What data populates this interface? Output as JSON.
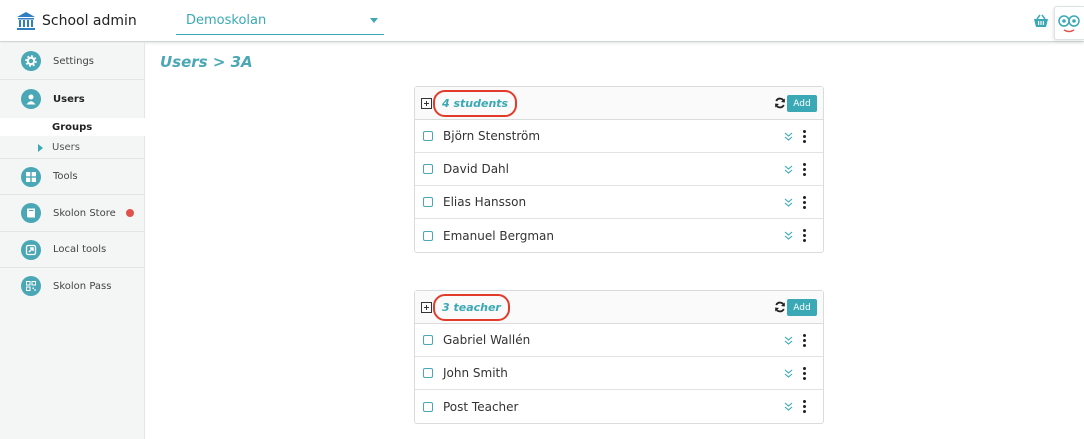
{
  "header": {
    "title": "School admin",
    "school_select": {
      "value": "Demoskolan"
    },
    "icons": {
      "brand": "bank-icon",
      "basket": "basket-icon",
      "avatar": "owl-avatar-icon"
    }
  },
  "sidebar": {
    "items": [
      {
        "label": "Settings",
        "icon": "gear-icon"
      },
      {
        "label": "Users",
        "icon": "user-icon",
        "active": true
      },
      {
        "label": "Tools",
        "icon": "grid-icon"
      },
      {
        "label": "Skolon Store",
        "icon": "book-icon",
        "badge": true
      },
      {
        "label": "Local tools",
        "icon": "external-arrow-icon"
      },
      {
        "label": "Skolon Pass",
        "icon": "qr-code-icon"
      }
    ],
    "sub_items": [
      {
        "label": "Groups"
      },
      {
        "label": "Users"
      }
    ]
  },
  "main": {
    "breadcrumb": "Users > 3A",
    "panels": [
      {
        "count_label": "4 students",
        "add_label": "Add",
        "rows": [
          {
            "name": "Björn Stenström"
          },
          {
            "name": "David Dahl"
          },
          {
            "name": "Elias Hansson"
          },
          {
            "name": "Emanuel Bergman"
          }
        ]
      },
      {
        "count_label": "3 teacher",
        "add_label": "Add",
        "rows": [
          {
            "name": "Gabriel Wallén"
          },
          {
            "name": "John Smith"
          },
          {
            "name": "Post Teacher"
          }
        ]
      }
    ]
  },
  "colors": {
    "accent": "#3aa9b5",
    "highlight_ring": "#e23b2b",
    "badge": "#e0524c"
  }
}
